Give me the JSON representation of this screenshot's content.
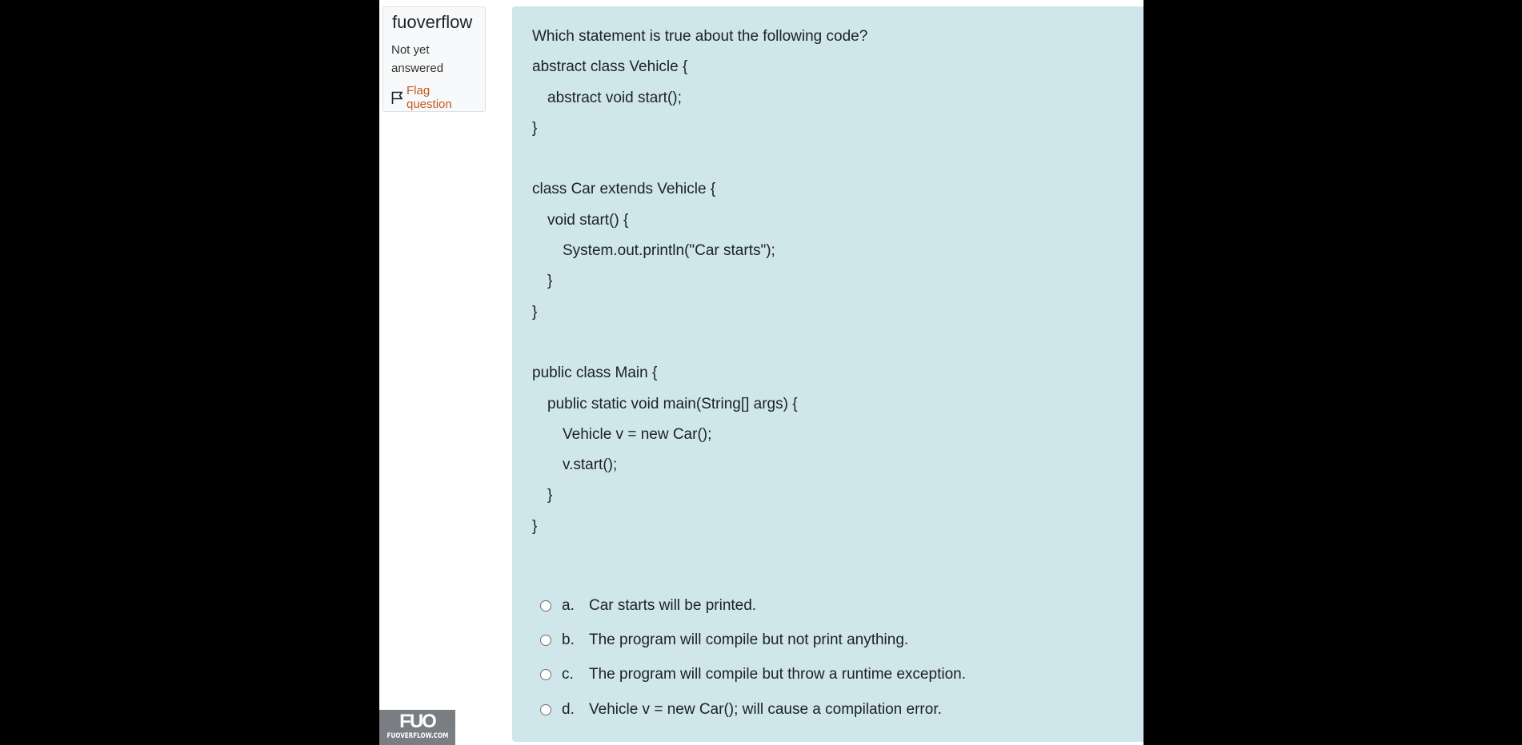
{
  "sidebar": {
    "question_name": "fuoverflow",
    "state": "Not yet answered",
    "flag_label": "Flag question",
    "flag_icon": "flag-icon"
  },
  "question": {
    "prompt": "Which statement is true about the following code?",
    "code_lines": [
      {
        "text": "abstract class Vehicle {",
        "indent": 0
      },
      {
        "text": "abstract void start();",
        "indent": 1
      },
      {
        "text": "}",
        "indent": 0
      },
      {
        "text": "",
        "indent": 0
      },
      {
        "text": "class Car extends Vehicle {",
        "indent": 0
      },
      {
        "text": "void start() {",
        "indent": 1
      },
      {
        "text": "System.out.println(\"Car starts\");",
        "indent": 2
      },
      {
        "text": "}",
        "indent": 1
      },
      {
        "text": "}",
        "indent": 0
      },
      {
        "text": "",
        "indent": 0
      },
      {
        "text": "public class Main {",
        "indent": 0
      },
      {
        "text": "public static void main(String[] args) {",
        "indent": 1
      },
      {
        "text": "Vehicle v = new Car();",
        "indent": 2
      },
      {
        "text": "v.start();",
        "indent": 2
      },
      {
        "text": "}",
        "indent": 1
      },
      {
        "text": "}",
        "indent": 0
      }
    ]
  },
  "answers": [
    {
      "letter": "a.",
      "text": "Car starts will be printed."
    },
    {
      "letter": "b.",
      "text": "The program will compile but not print anything."
    },
    {
      "letter": "c.",
      "text": "The program will compile but throw a runtime exception."
    },
    {
      "letter": "d.",
      "text": "Vehicle v = new Car(); will cause a compilation error."
    }
  ],
  "watermark": {
    "logo": "FUO",
    "url": "FUOVERFLOW.COM"
  },
  "colors": {
    "content_background": "#cfe6ea",
    "flag_text": "#c2581f",
    "page_background": "#000000"
  }
}
